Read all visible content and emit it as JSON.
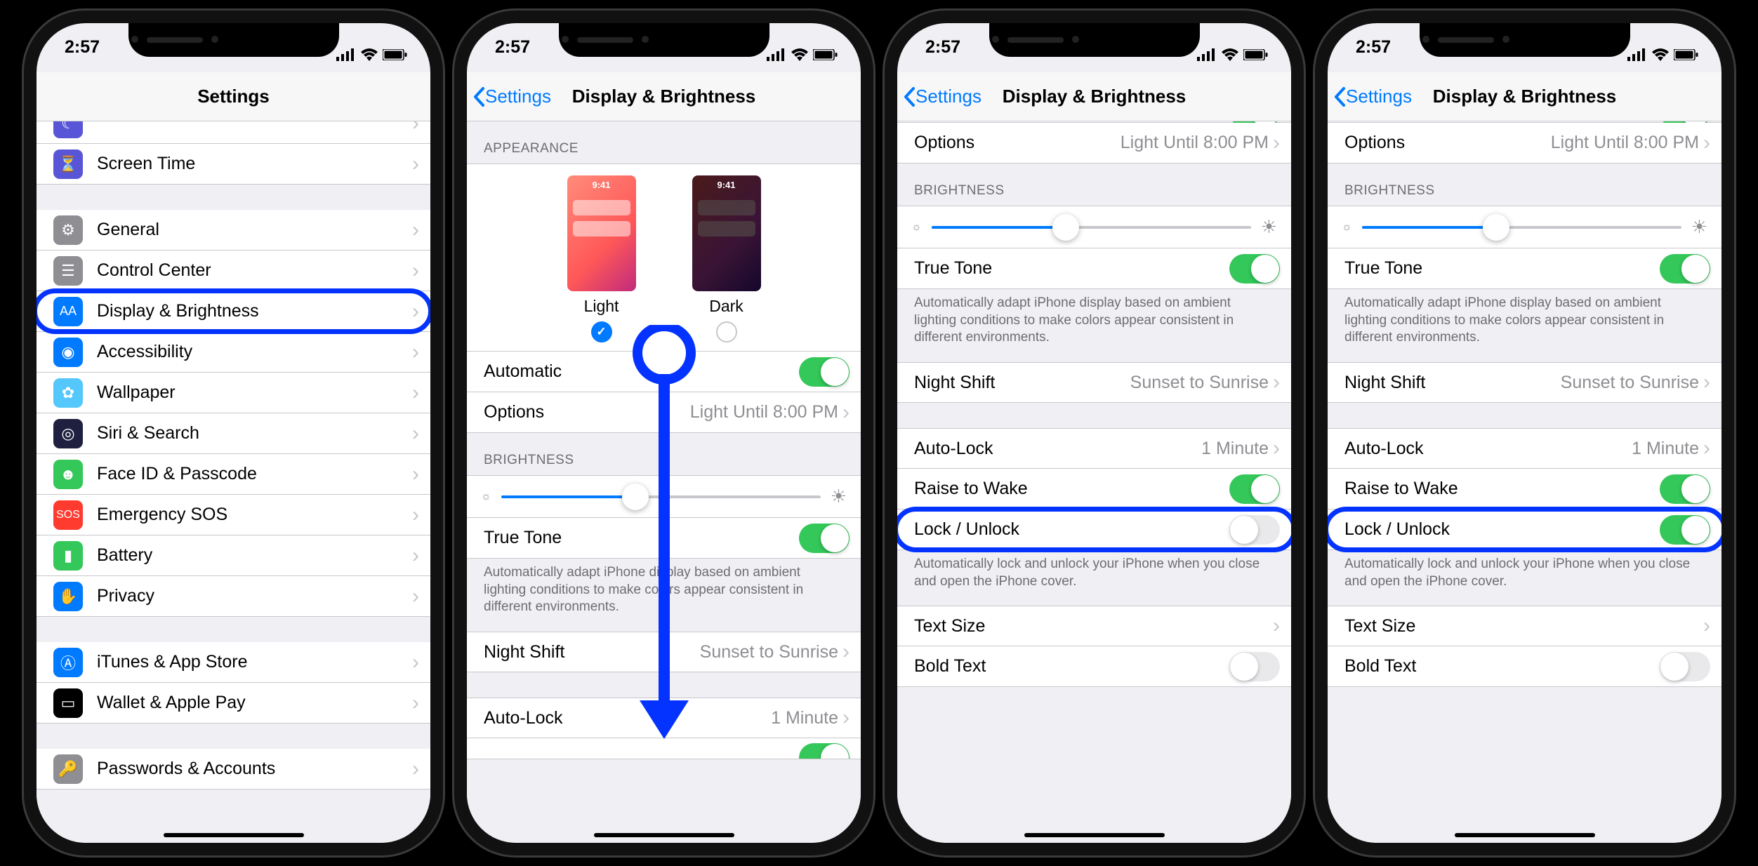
{
  "status": {
    "time": "2:57"
  },
  "screen1": {
    "title": "Settings",
    "rows": [
      {
        "label": "Screen Time"
      },
      {
        "label": "General"
      },
      {
        "label": "Control Center"
      },
      {
        "label": "Display & Brightness"
      },
      {
        "label": "Accessibility"
      },
      {
        "label": "Wallpaper"
      },
      {
        "label": "Siri & Search"
      },
      {
        "label": "Face ID & Passcode"
      },
      {
        "label": "Emergency SOS"
      },
      {
        "label": "Battery"
      },
      {
        "label": "Privacy"
      },
      {
        "label": "iTunes & App Store"
      },
      {
        "label": "Wallet & Apple Pay"
      },
      {
        "label": "Passwords & Accounts"
      }
    ]
  },
  "displayNav": {
    "back": "Settings",
    "title": "Display & Brightness"
  },
  "appearance": {
    "header": "APPEARANCE",
    "light": "Light",
    "dark": "Dark",
    "thumbTime": "9:41",
    "automatic": "Automatic",
    "options": "Options",
    "optionsDetail": "Light Until 8:00 PM"
  },
  "brightness": {
    "header": "BRIGHTNESS",
    "trueTone": "True Tone",
    "trueToneFooter": "Automatically adapt iPhone display based on ambient lighting conditions to make colors appear consistent in different environments."
  },
  "nightShift": {
    "label": "Night Shift",
    "detail": "Sunset to Sunrise"
  },
  "autoLock": {
    "label": "Auto-Lock",
    "detail": "1 Minute"
  },
  "raiseToWake": "Raise to Wake",
  "lockUnlock": "Lock / Unlock",
  "lockUnlockFooter": "Automatically lock and unlock your iPhone when you close and open the iPhone cover.",
  "textSize": "Text Size",
  "boldText": "Bold Text"
}
